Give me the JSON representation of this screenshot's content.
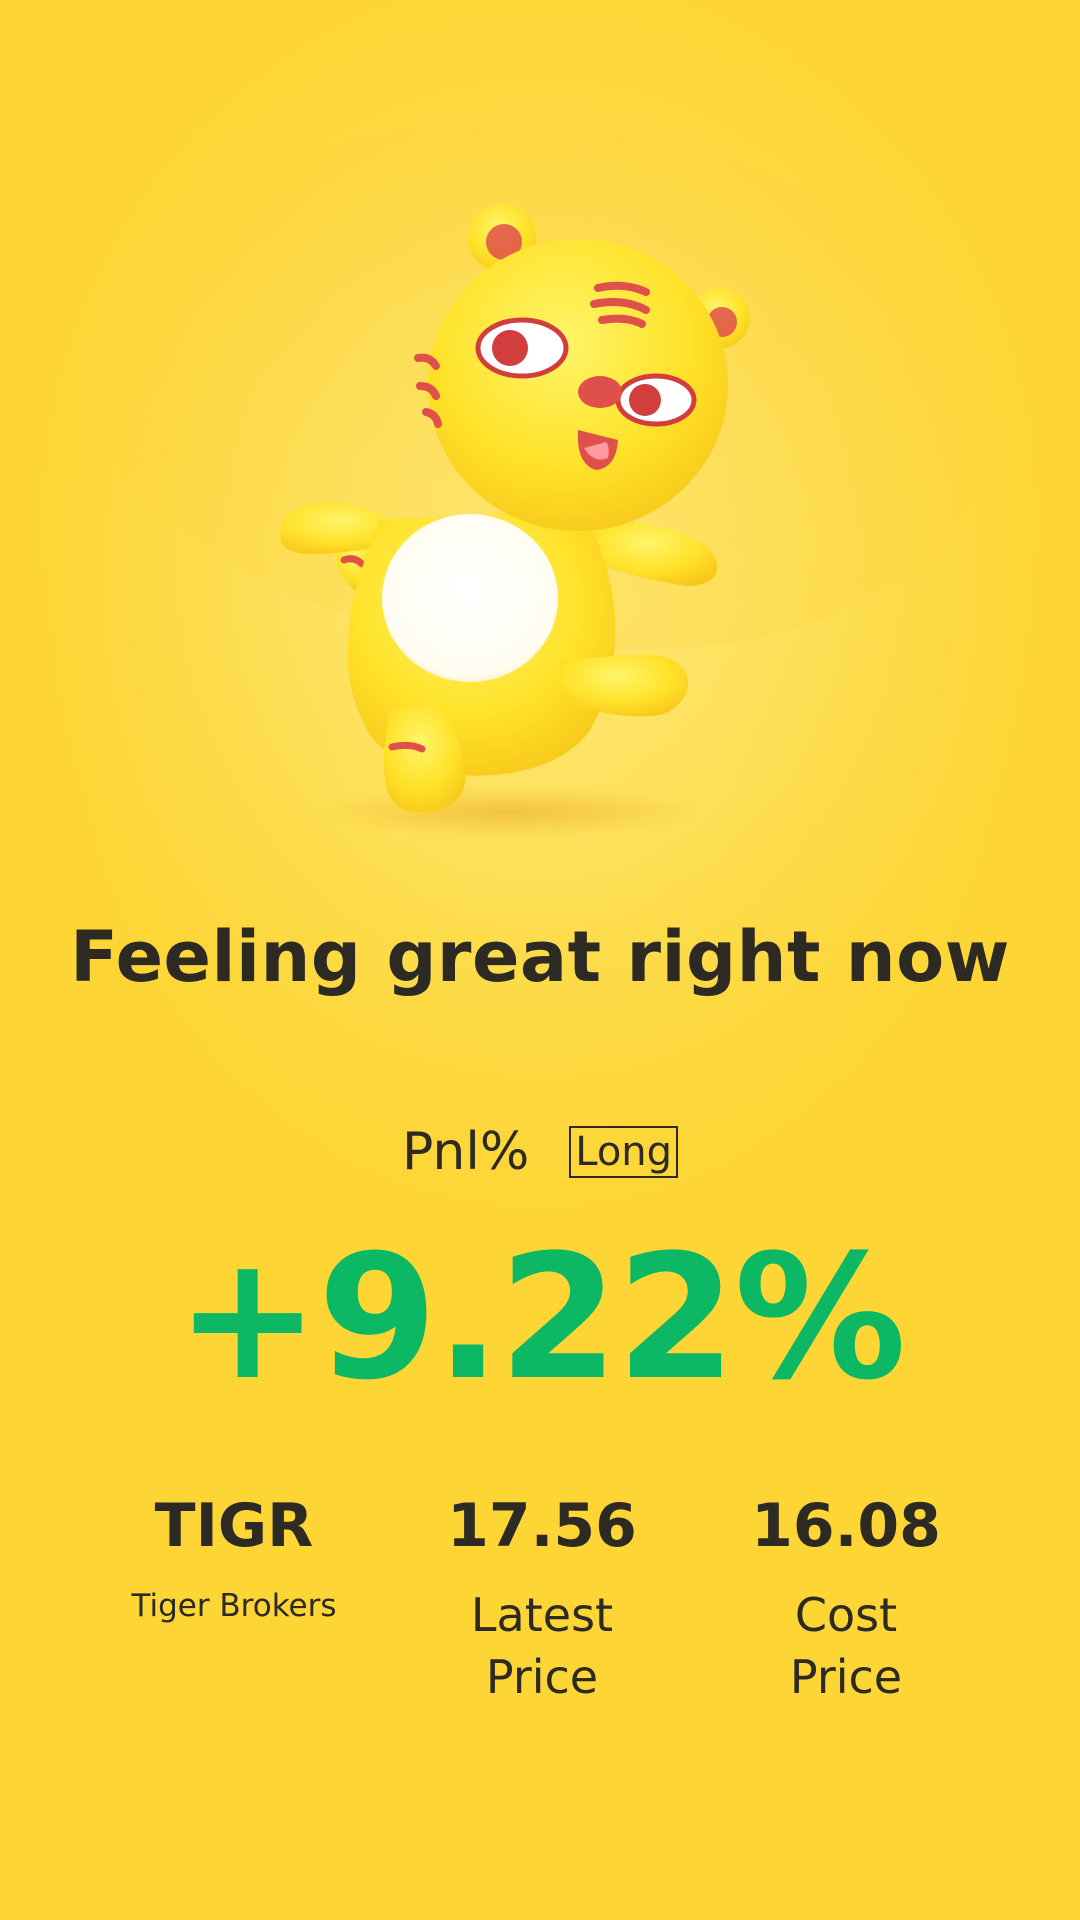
{
  "screen": {
    "background_color": "#fdd83f"
  },
  "mascot": {
    "icon": "tiger-mascot-icon",
    "primary_color": "#ffe53a",
    "accent_color": "#e0504a"
  },
  "headline": "Feeling great right now",
  "pnl": {
    "label": "Pnl%",
    "position_badge": "Long",
    "value": "+9.22%",
    "value_color": "#0cb864"
  },
  "stats": {
    "symbol": "TIGR",
    "company_name": "Tiger Brokers",
    "latest_price": "17.56",
    "latest_price_label": "Latest Price",
    "cost_price": "16.08",
    "cost_price_label": "Cost Price"
  }
}
